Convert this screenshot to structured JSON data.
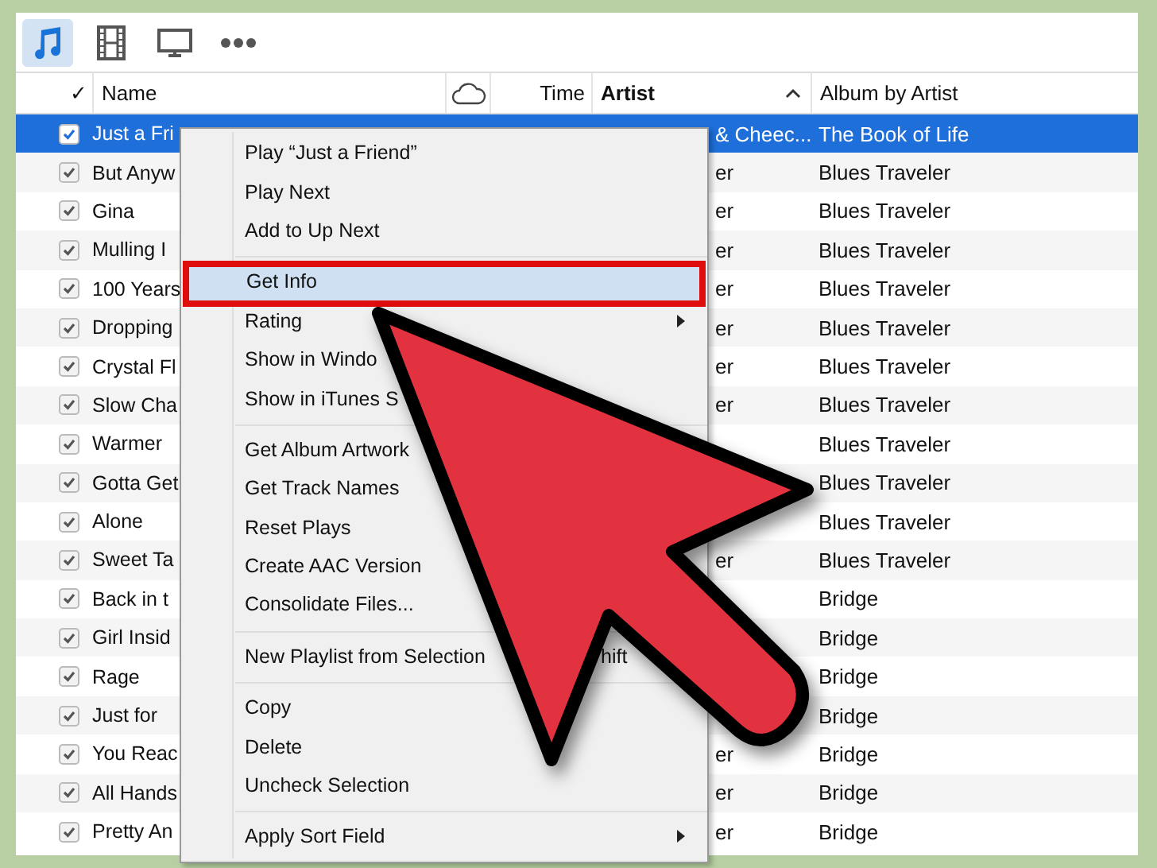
{
  "toolbar": {
    "items": [
      {
        "kind": "music",
        "selected": true
      },
      {
        "kind": "film",
        "selected": false
      },
      {
        "kind": "tv",
        "selected": false
      },
      {
        "kind": "more",
        "selected": false
      }
    ]
  },
  "table": {
    "columns": [
      {
        "kind": "check",
        "label": "✓"
      },
      {
        "kind": "name",
        "label": "Name"
      },
      {
        "kind": "cloud"
      },
      {
        "kind": "time",
        "label": "Time"
      },
      {
        "kind": "artist",
        "label": "Artist",
        "sorted": true
      },
      {
        "kind": "album",
        "label": "Album by Artist"
      }
    ],
    "rows": [
      {
        "checked": true,
        "selected": true,
        "name": "Just a Fri",
        "artist": "& Cheec...",
        "album": "The Book of Life"
      },
      {
        "checked": true,
        "selected": false,
        "name": "But Anyw",
        "artist": "er",
        "album": "Blues Traveler"
      },
      {
        "checked": true,
        "selected": false,
        "name": "Gina",
        "artist": "er",
        "album": "Blues Traveler"
      },
      {
        "checked": true,
        "selected": false,
        "name": "Mulling I",
        "artist": "er",
        "album": "Blues Traveler"
      },
      {
        "checked": true,
        "selected": false,
        "name": "100 Years",
        "artist": "er",
        "album": "Blues Traveler"
      },
      {
        "checked": true,
        "selected": false,
        "name": "Dropping",
        "artist": "er",
        "album": "Blues Traveler"
      },
      {
        "checked": true,
        "selected": false,
        "name": "Crystal Fl",
        "artist": "er",
        "album": "Blues Traveler"
      },
      {
        "checked": true,
        "selected": false,
        "name": "Slow Cha",
        "artist": "er",
        "album": "Blues Traveler"
      },
      {
        "checked": true,
        "selected": false,
        "name": "Warmer",
        "album": "Blues Traveler"
      },
      {
        "checked": true,
        "selected": false,
        "name": "Gotta Get",
        "album": "Blues Traveler"
      },
      {
        "checked": true,
        "selected": false,
        "name": "Alone",
        "album": "Blues Traveler"
      },
      {
        "checked": true,
        "selected": false,
        "name": "Sweet Ta",
        "artist": "er",
        "album": "Blues Traveler"
      },
      {
        "checked": true,
        "selected": false,
        "name": "Back in t",
        "album": "Bridge"
      },
      {
        "checked": true,
        "selected": false,
        "name": "Girl Insid",
        "album": "Bridge"
      },
      {
        "checked": true,
        "selected": false,
        "name": "Rage",
        "album": "Bridge"
      },
      {
        "checked": true,
        "selected": false,
        "name": "Just for",
        "album": "Bridge"
      },
      {
        "checked": true,
        "selected": false,
        "name": "You Reac",
        "artist": "er",
        "album": "Bridge"
      },
      {
        "checked": true,
        "selected": false,
        "name": "All Hands",
        "artist": "er",
        "album": "Bridge"
      },
      {
        "checked": true,
        "selected": false,
        "name": "Pretty An",
        "artist": "er",
        "album": "Bridge"
      }
    ]
  },
  "context_menu": {
    "items": [
      {
        "kind": "item",
        "label": "Play “Just a Friend”",
        "highlighted": false
      },
      {
        "kind": "item",
        "label": "Play Next",
        "highlighted": false
      },
      {
        "kind": "item",
        "label": "Add to Up Next",
        "highlighted": false
      },
      {
        "kind": "separator"
      },
      {
        "kind": "item",
        "label": "Get Info",
        "highlighted": true,
        "callout": true
      },
      {
        "kind": "item",
        "label": "Rating",
        "highlighted": false,
        "submenu": true
      },
      {
        "kind": "item",
        "label": "Show in Windo",
        "highlighted": false
      },
      {
        "kind": "item",
        "label": "Show in iTunes S",
        "highlighted": false
      },
      {
        "kind": "separator"
      },
      {
        "kind": "item",
        "label": "Get Album Artwork",
        "highlighted": false
      },
      {
        "kind": "item",
        "label": "Get Track Names",
        "highlighted": false
      },
      {
        "kind": "item",
        "label": "Reset Plays",
        "highlighted": false
      },
      {
        "kind": "item",
        "label": "Create AAC Version",
        "highlighted": false
      },
      {
        "kind": "item",
        "label": "Consolidate Files...",
        "highlighted": false
      },
      {
        "kind": "separator"
      },
      {
        "kind": "item",
        "label": "New Playlist from Selection",
        "shortcut": "hift",
        "highlighted": false
      },
      {
        "kind": "separator"
      },
      {
        "kind": "item",
        "label": "Copy",
        "highlighted": false
      },
      {
        "kind": "item",
        "label": "Delete",
        "highlighted": false
      },
      {
        "kind": "item",
        "label": "Uncheck Selection",
        "highlighted": false
      },
      {
        "kind": "separator"
      },
      {
        "kind": "item",
        "label": "Apply Sort Field",
        "highlighted": false,
        "submenu": true
      }
    ]
  }
}
